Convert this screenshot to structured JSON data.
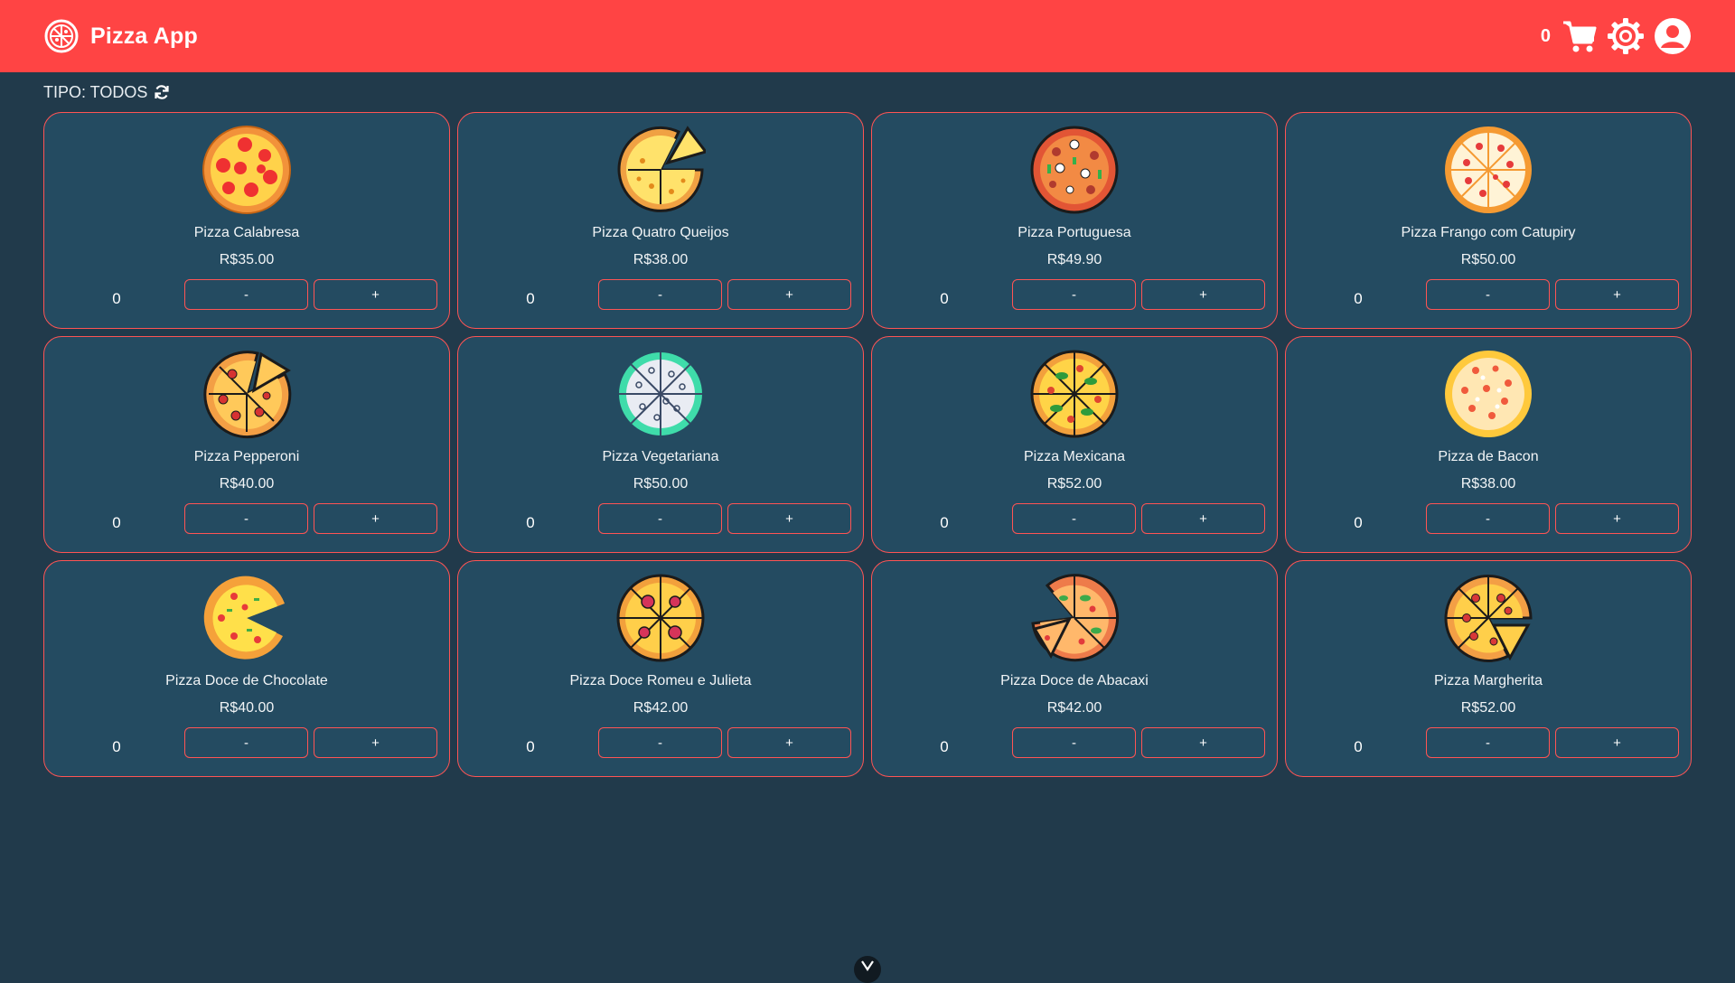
{
  "app": {
    "title": "Pizza App"
  },
  "header": {
    "cart_count": "0"
  },
  "filter": {
    "label": "TIPO: TODOS"
  },
  "colors": {
    "header_bg": "#ff4444",
    "page_bg": "#213a4b",
    "card_bg": "#244b61",
    "accent_border": "#ff5454"
  },
  "pizzas": [
    {
      "name": "Pizza Calabresa",
      "price": "R$35.00",
      "qty": "0",
      "minus": "-",
      "plus": "+"
    },
    {
      "name": "Pizza Quatro Queijos",
      "price": "R$38.00",
      "qty": "0",
      "minus": "-",
      "plus": "+"
    },
    {
      "name": "Pizza Portuguesa",
      "price": "R$49.90",
      "qty": "0",
      "minus": "-",
      "plus": "+"
    },
    {
      "name": "Pizza Frango com Catupiry",
      "price": "R$50.00",
      "qty": "0",
      "minus": "-",
      "plus": "+"
    },
    {
      "name": "Pizza Pepperoni",
      "price": "R$40.00",
      "qty": "0",
      "minus": "-",
      "plus": "+"
    },
    {
      "name": "Pizza Vegetariana",
      "price": "R$50.00",
      "qty": "0",
      "minus": "-",
      "plus": "+"
    },
    {
      "name": "Pizza Mexicana",
      "price": "R$52.00",
      "qty": "0",
      "minus": "-",
      "plus": "+"
    },
    {
      "name": "Pizza de Bacon",
      "price": "R$38.00",
      "qty": "0",
      "minus": "-",
      "plus": "+"
    },
    {
      "name": "Pizza Doce de Chocolate",
      "price": "R$40.00",
      "qty": "0",
      "minus": "-",
      "plus": "+"
    },
    {
      "name": "Pizza Doce Romeu e Julieta",
      "price": "R$42.00",
      "qty": "0",
      "minus": "-",
      "plus": "+"
    },
    {
      "name": "Pizza Doce de Abacaxi",
      "price": "R$42.00",
      "qty": "0",
      "minus": "-",
      "plus": "+"
    },
    {
      "name": "Pizza Margherita",
      "price": "R$52.00",
      "qty": "0",
      "minus": "-",
      "plus": "+"
    }
  ]
}
